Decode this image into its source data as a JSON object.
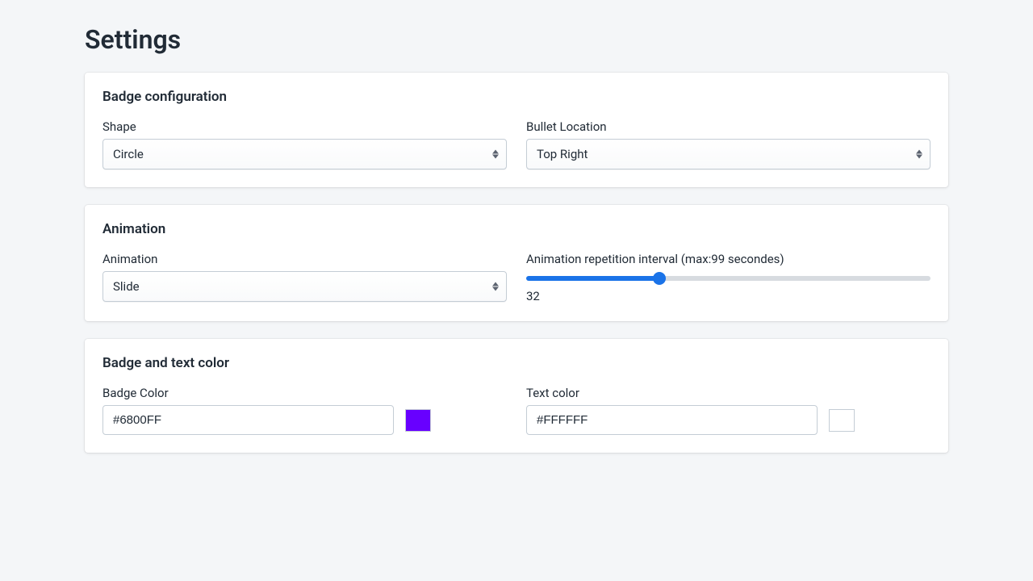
{
  "page": {
    "title": "Settings"
  },
  "badge_config": {
    "title": "Badge configuration",
    "shape": {
      "label": "Shape",
      "value": "Circle"
    },
    "bullet_location": {
      "label": "Bullet Location",
      "value": "Top Right"
    }
  },
  "animation": {
    "title": "Animation",
    "animation_type": {
      "label": "Animation",
      "value": "Slide"
    },
    "interval": {
      "label": "Animation repetition interval (max:99 secondes)",
      "value": "32",
      "max": "99",
      "pct": "32.3%"
    }
  },
  "colors": {
    "title": "Badge and text color",
    "badge_color": {
      "label": "Badge Color",
      "value": "#6800FF"
    },
    "text_color": {
      "label": "Text color",
      "value": "#FFFFFF"
    }
  }
}
